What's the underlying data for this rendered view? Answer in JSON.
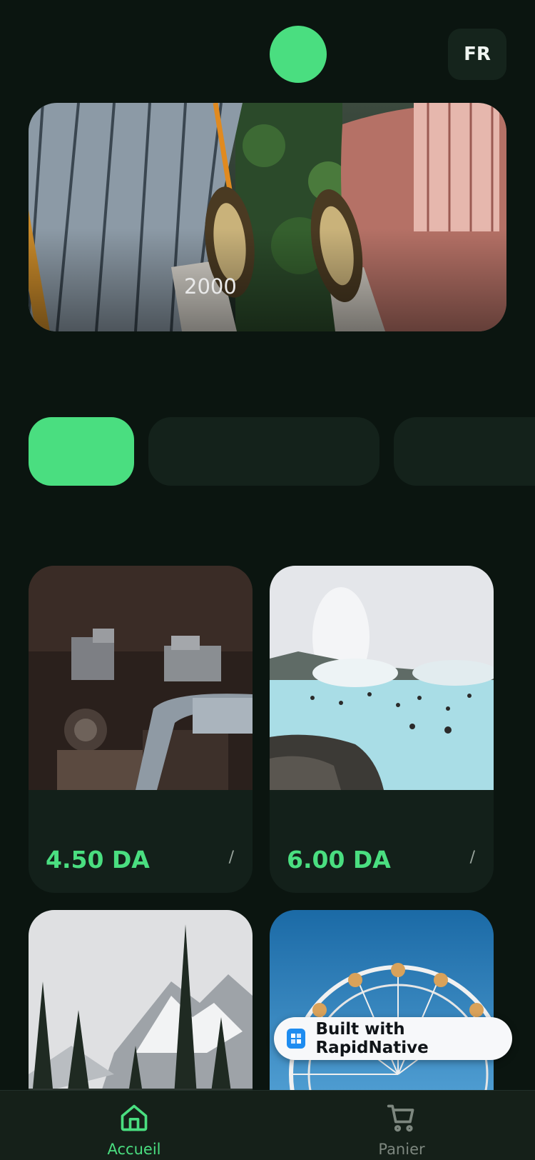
{
  "header": {
    "language_label": "FR"
  },
  "hero": {
    "caption": "2000"
  },
  "categories": {
    "chips": [
      {
        "label": "",
        "active": true
      },
      {
        "label": "",
        "active": false
      },
      {
        "label": "",
        "active": false
      }
    ]
  },
  "products": [
    {
      "name": "",
      "price": "4.50 DA",
      "unit": "/"
    },
    {
      "name": "",
      "price": "6.00 DA",
      "unit": "/"
    },
    {
      "name": "",
      "price": "",
      "unit": ""
    },
    {
      "name": "",
      "price": "",
      "unit": ""
    }
  ],
  "badge": {
    "label": "Built with RapidNative"
  },
  "tabbar": {
    "home_label": "Accueil",
    "cart_label": "Panier"
  },
  "colors": {
    "background": "#0b1510",
    "accent": "#4ade80",
    "surface": "#14221b",
    "inactive": "#7d877f"
  }
}
